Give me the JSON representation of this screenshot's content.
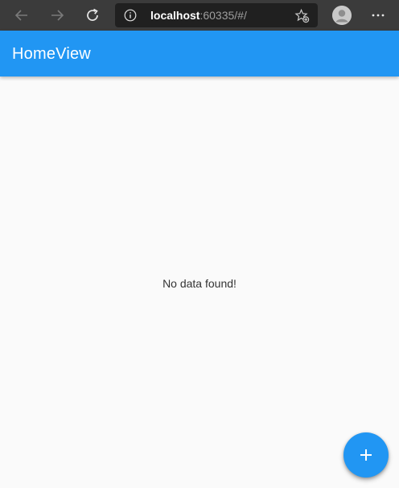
{
  "browser": {
    "url_host": "localhost",
    "url_rest": ":60335/#/",
    "icons": {
      "back": "arrow-left-icon",
      "forward": "arrow-right-icon",
      "refresh": "refresh-icon",
      "info": "info-icon",
      "favorites": "add-favorite-icon",
      "profile": "profile-avatar-icon",
      "more": "more-horizontal-icon"
    }
  },
  "appbar": {
    "title": "HomeView"
  },
  "main": {
    "empty_message": "No data found!"
  },
  "fab": {
    "icon": "plus-icon"
  },
  "colors": {
    "primary": "#2196f3",
    "background": "#fafafa",
    "browser_chrome": "#3b3b3b"
  }
}
